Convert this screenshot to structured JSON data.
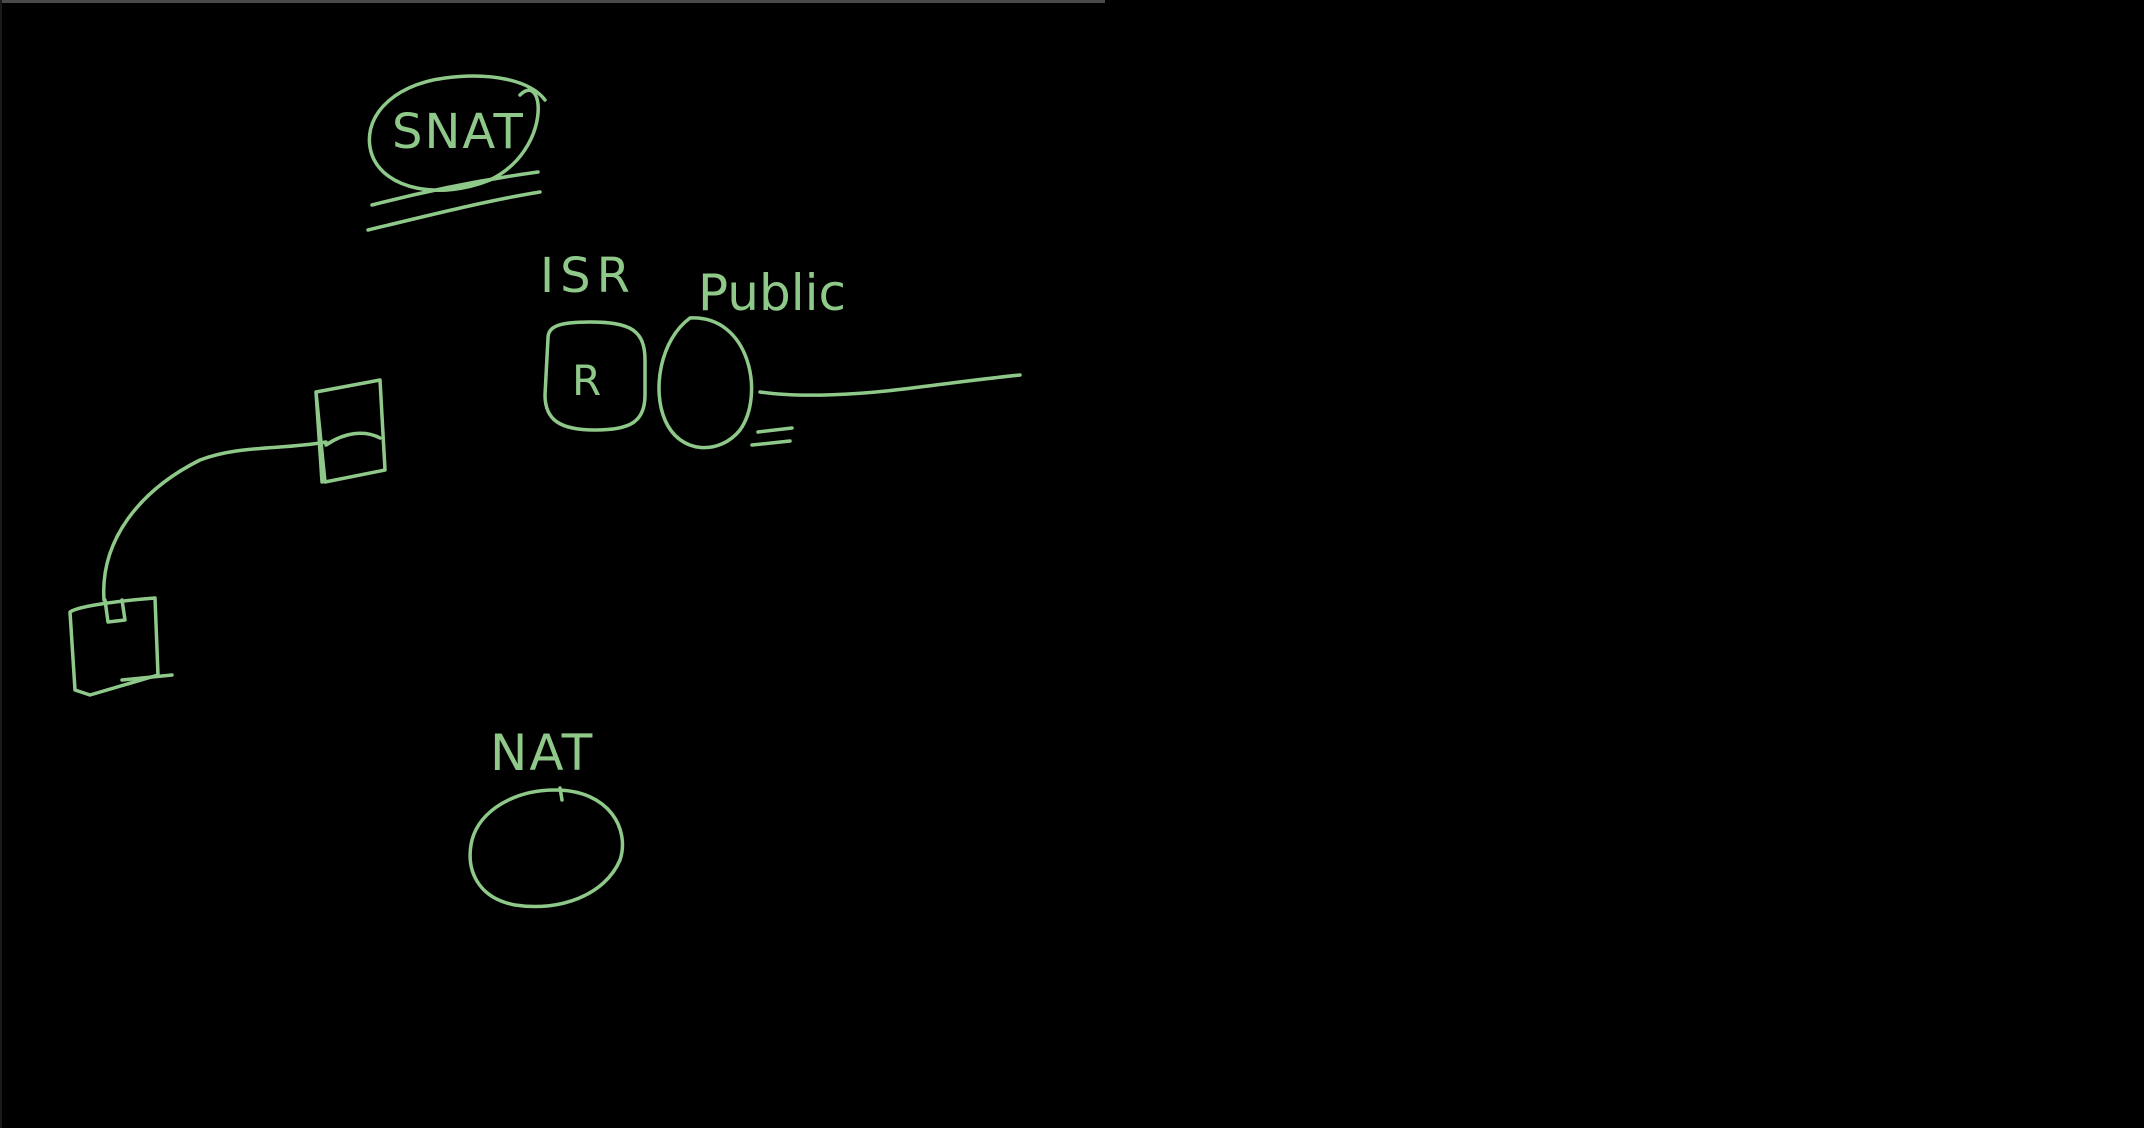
{
  "colors": {
    "background": "#000000",
    "ink": "#8fc98a"
  },
  "labels": {
    "snat": "SNAT",
    "isr": "ISR",
    "router": "R",
    "public": "Public",
    "nat": "NAT"
  }
}
